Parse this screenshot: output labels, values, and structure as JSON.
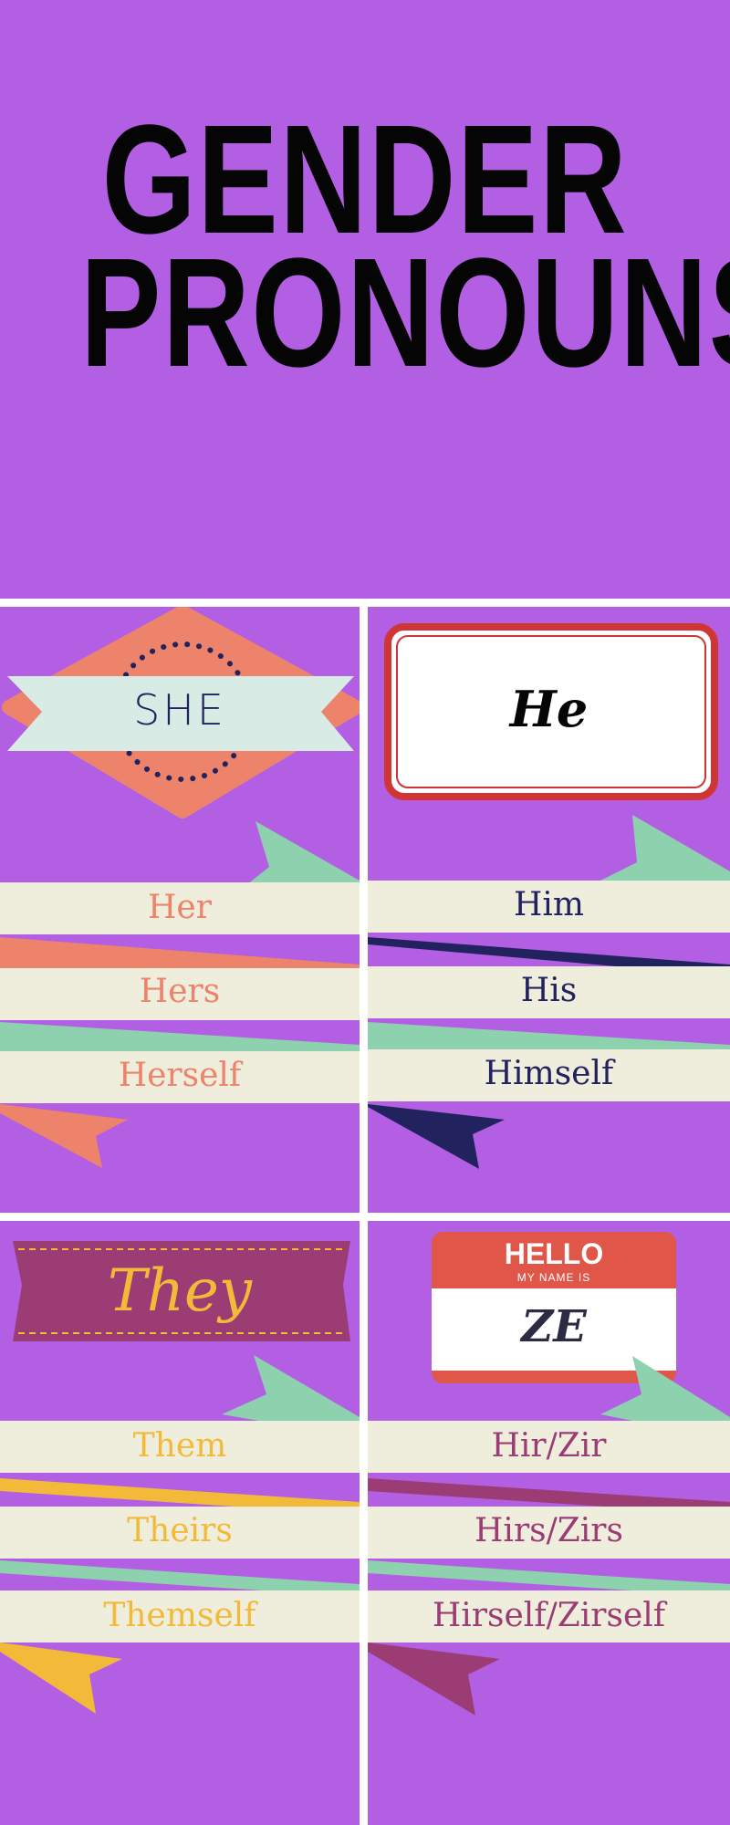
{
  "title": {
    "line1": "GENDER",
    "line2": "PRONOUNS"
  },
  "colors": {
    "background": "#b35fe3",
    "divider": "#ffffff",
    "ribbon_band": "#efeedd",
    "mint": "#8dd1ae",
    "coral": "#ee836b",
    "navy": "#22225e",
    "yellow": "#f3ba3a",
    "plum": "#9b3d74"
  },
  "panels": {
    "she": {
      "heading": "SHE",
      "icon": "diamond-ribbon-badge",
      "text_color": "#ee836b",
      "words": [
        "Her",
        "Hers",
        "Herself"
      ]
    },
    "he": {
      "heading": "He",
      "icon": "framed-name-card",
      "text_color": "#22225e",
      "words": [
        "Him",
        "His",
        "Himself"
      ]
    },
    "they": {
      "heading": "They",
      "icon": "banner-label",
      "text_color": "#f3ba3a",
      "words": [
        "Them",
        "Theirs",
        "Themself"
      ]
    },
    "ze": {
      "tag_hello": "HELLO",
      "tag_subtitle": "MY NAME IS",
      "heading": "ZE",
      "icon": "hello-name-tag",
      "text_color": "#9b3d74",
      "words": [
        "Hir/Zir",
        "Hirs/Zirs",
        "Hirself/Zirself"
      ]
    }
  }
}
